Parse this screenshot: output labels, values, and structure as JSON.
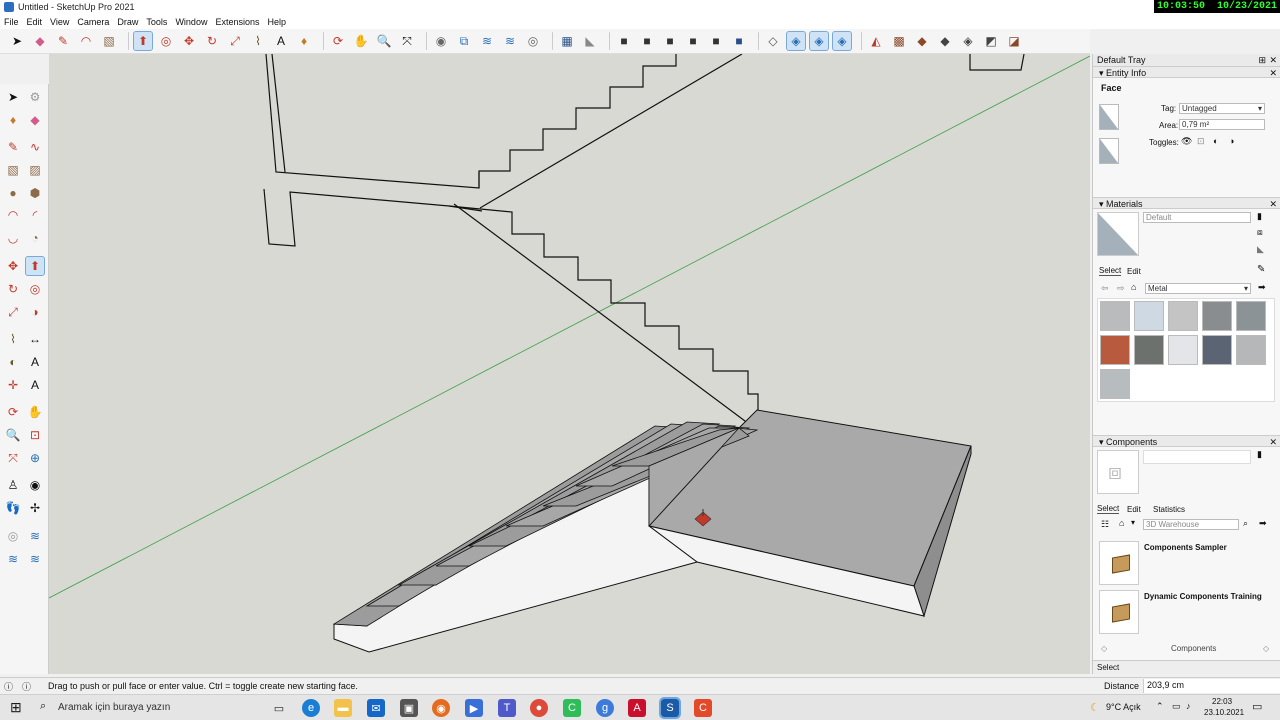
{
  "window": {
    "title": "Untitled - SketchUp Pro 2021"
  },
  "clock": {
    "time": "10:03:50",
    "date": "10/23/2021"
  },
  "menu": [
    "File",
    "Edit",
    "View",
    "Camera",
    "Draw",
    "Tools",
    "Window",
    "Extensions",
    "Help"
  ],
  "tray": {
    "title": "Default Tray",
    "entity_info": {
      "header": "Entity Info",
      "entity_type": "Face",
      "tag_label": "Tag:",
      "tag_value": "Untagged",
      "area_label": "Area:",
      "area_value": "0,79 m²",
      "toggles_label": "Toggles:"
    },
    "materials": {
      "header": "Materials",
      "name": "Default",
      "tab_select": "Select",
      "tab_edit": "Edit",
      "library": "Metal",
      "swatch_colors": [
        "#b9bbbc",
        "#cfd9e3",
        "#c4c4c4",
        "#8a8d90",
        "#8c9397",
        "#b85a3e",
        "#6d716e",
        "#e3e5e8",
        "#5a6473",
        "#b5b7b8",
        "#b7bcbf"
      ]
    },
    "components": {
      "header": "Components",
      "tab_select": "Select",
      "tab_edit": "Edit",
      "tab_statistics": "Statistics",
      "search_placeholder": "3D Warehouse",
      "items": [
        "Components Sampler",
        "Dynamic Components Training"
      ],
      "footer": "Components"
    },
    "bottom": "Select"
  },
  "status": {
    "message": "Drag to push or pull face or enter value.  Ctrl = toggle create new starting face.",
    "measure_label": "Distance",
    "measure_value": "203,9 cm"
  },
  "taskbar": {
    "search_placeholder": "Aramak için buraya yazın",
    "weather": "9°C  Açık",
    "time": "22:03",
    "date": "23.10.2021"
  }
}
